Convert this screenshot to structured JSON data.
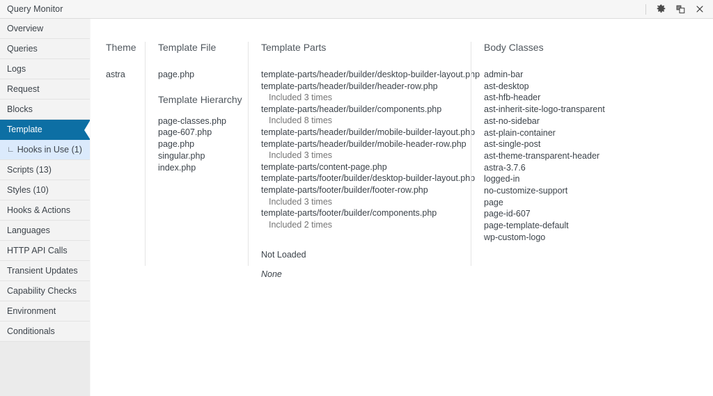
{
  "window": {
    "title": "Query Monitor",
    "actions": [
      {
        "name": "settings-icon",
        "label": "Settings"
      },
      {
        "name": "dock-icon",
        "label": "Dock"
      },
      {
        "name": "close-icon",
        "label": "Close"
      }
    ]
  },
  "sidebar": {
    "items": [
      {
        "label": "Overview",
        "active": false,
        "sub": false
      },
      {
        "label": "Queries",
        "active": false,
        "sub": false
      },
      {
        "label": "Logs",
        "active": false,
        "sub": false
      },
      {
        "label": "Request",
        "active": false,
        "sub": false
      },
      {
        "label": "Blocks",
        "active": false,
        "sub": false
      },
      {
        "label": "Template",
        "active": true,
        "sub": false
      },
      {
        "label": "Hooks in Use (1)",
        "active": false,
        "sub": true
      },
      {
        "label": "Scripts (13)",
        "active": false,
        "sub": false
      },
      {
        "label": "Styles (10)",
        "active": false,
        "sub": false
      },
      {
        "label": "Hooks & Actions",
        "active": false,
        "sub": false
      },
      {
        "label": "Languages",
        "active": false,
        "sub": false
      },
      {
        "label": "HTTP API Calls",
        "active": false,
        "sub": false
      },
      {
        "label": "Transient Updates",
        "active": false,
        "sub": false
      },
      {
        "label": "Capability Checks",
        "active": false,
        "sub": false
      },
      {
        "label": "Environment",
        "active": false,
        "sub": false
      },
      {
        "label": "Conditionals",
        "active": false,
        "sub": false
      }
    ],
    "branch_glyph": "∟"
  },
  "main": {
    "theme": {
      "heading": "Theme",
      "value": "astra"
    },
    "template_file": {
      "heading": "Template File",
      "value": "page.php",
      "hierarchy_heading": "Template Hierarchy",
      "hierarchy": [
        "page-classes.php",
        "page-607.php",
        "page.php",
        "singular.php",
        "index.php"
      ]
    },
    "template_parts": {
      "heading": "Template Parts",
      "items": [
        {
          "path": "template-parts/header/builder/desktop-builder-layout.php",
          "note": ""
        },
        {
          "path": "template-parts/header/builder/header-row.php",
          "note": "Included 3 times"
        },
        {
          "path": "template-parts/header/builder/components.php",
          "note": "Included 8 times"
        },
        {
          "path": "template-parts/header/builder/mobile-builder-layout.php",
          "note": ""
        },
        {
          "path": "template-parts/header/builder/mobile-header-row.php",
          "note": "Included 3 times"
        },
        {
          "path": "template-parts/content-page.php",
          "note": ""
        },
        {
          "path": "template-parts/footer/builder/desktop-builder-layout.php",
          "note": ""
        },
        {
          "path": "template-parts/footer/builder/footer-row.php",
          "note": "Included 3 times"
        },
        {
          "path": "template-parts/footer/builder/components.php",
          "note": "Included 2 times"
        }
      ],
      "not_loaded_heading": "Not Loaded",
      "not_loaded_value": "None"
    },
    "body_classes": {
      "heading": "Body Classes",
      "items": [
        "admin-bar",
        "ast-desktop",
        "ast-hfb-header",
        "ast-inherit-site-logo-transparent",
        "ast-no-sidebar",
        "ast-plain-container",
        "ast-single-post",
        "ast-theme-transparent-header",
        "astra-3.7.6",
        "logged-in",
        "no-customize-support",
        "page",
        "page-id-607",
        "page-template-default",
        "wp-custom-logo"
      ]
    }
  },
  "colors": {
    "accent": "#0d6fa4",
    "sub_active": "#dbeafc",
    "sidebar_bg": "#f3f3f3",
    "panel_bg": "#ffffff"
  }
}
